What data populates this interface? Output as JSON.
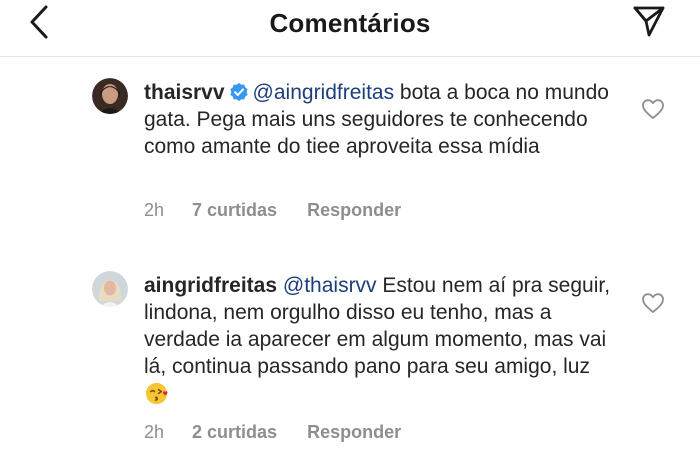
{
  "header": {
    "title": "Comentários",
    "back_icon": "chevron-left-icon",
    "send_icon": "paper-plane-icon"
  },
  "comments": [
    {
      "username": "thaisrvv",
      "verified": true,
      "mention": "@aingridfreitas",
      "text": " bota a boca no mundo gata. Pega mais uns seguidores te conhecendo como amante do tiee aproveita essa mídia",
      "time": "2h",
      "likes": "7 curtidas",
      "reply": "Responder"
    },
    {
      "username": "aingridfreitas",
      "verified": false,
      "mention": "@thaisrvv",
      "text": " Estou nem aí pra seguir, lindona, nem orgulho disso eu tenho, mas a verdade ia aparecer em algum momento, mas vai lá, continua passando pano para seu amigo, luz",
      "emoji": "face-blowing-kiss-emoji",
      "time": "2h",
      "likes": "2 curtidas",
      "reply": "Responder"
    }
  ],
  "colors": {
    "mention": "#1c3f7a",
    "verified": "#3897f0",
    "meta": "#8e8e8e"
  }
}
